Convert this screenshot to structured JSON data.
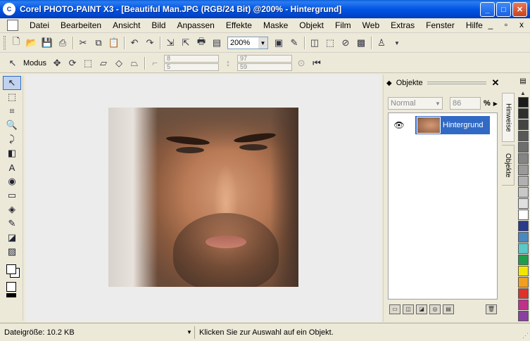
{
  "window": {
    "title": "Corel PHOTO-PAINT X3 - [Beautiful Man.JPG (RGB/24 Bit) @200% - Hintergrund]",
    "app_icon": "corel-balloon-icon",
    "controls": {
      "minimize": "_",
      "maximize": "□",
      "close": "✕"
    }
  },
  "menubar": {
    "items": [
      "Datei",
      "Bearbeiten",
      "Ansicht",
      "Bild",
      "Anpassen",
      "Effekte",
      "Maske",
      "Objekt",
      "Film",
      "Web",
      "Extras",
      "Fenster",
      "Hilfe"
    ],
    "mdi_controls": {
      "minimize": "_",
      "restore": "▫",
      "close": "x"
    }
  },
  "toolbar_standard": {
    "icons": [
      "new-icon",
      "open-icon",
      "save-icon",
      "scan-icon",
      "cut-icon",
      "copy-icon",
      "paste-icon",
      "undo-icon",
      "redo-icon",
      "import-icon",
      "export-icon",
      "print-icon",
      "launcher-icon"
    ],
    "zoom_value": "200%",
    "extra_icons": [
      "full-screen-icon",
      "eyedropper-icon",
      "mask-icon",
      "mask-marquee-icon",
      "clip-icon",
      "lock-icon",
      "dropdown-icon"
    ]
  },
  "toolbar_property": {
    "modus_label": "Modus",
    "x_value": "8",
    "y_value": "5",
    "w_value": "97",
    "h_value": "59"
  },
  "objects_docker": {
    "title": "Objekte",
    "blend_mode": "Normal",
    "opacity": "86",
    "opacity_unit": "%",
    "objects": [
      {
        "name": "Hintergrund",
        "visible": true,
        "selected": true
      }
    ]
  },
  "docker_tabs": [
    "Hinweise",
    "Objekte"
  ],
  "palette": {
    "colors": [
      "#1a1a1a",
      "#2e2e2e",
      "#444444",
      "#585858",
      "#6e6e6e",
      "#848484",
      "#9a9a9a",
      "#b0b0b0",
      "#c8c8c8",
      "#e0e0e0",
      "#ffffff",
      "#2a3a8c",
      "#4a88c0",
      "#5ac8c8",
      "#1e9e4a",
      "#f2e600",
      "#f0a020",
      "#e0302a",
      "#c0308a",
      "#8a40a0"
    ]
  },
  "statusbar": {
    "file_size": "Dateigröße: 10.2 KB",
    "hint": "Klicken Sie zur Auswahl auf ein Objekt."
  },
  "colors": {
    "titlebar": "#0055e5",
    "selection": "#316ac5",
    "chrome": "#ece9d8"
  }
}
